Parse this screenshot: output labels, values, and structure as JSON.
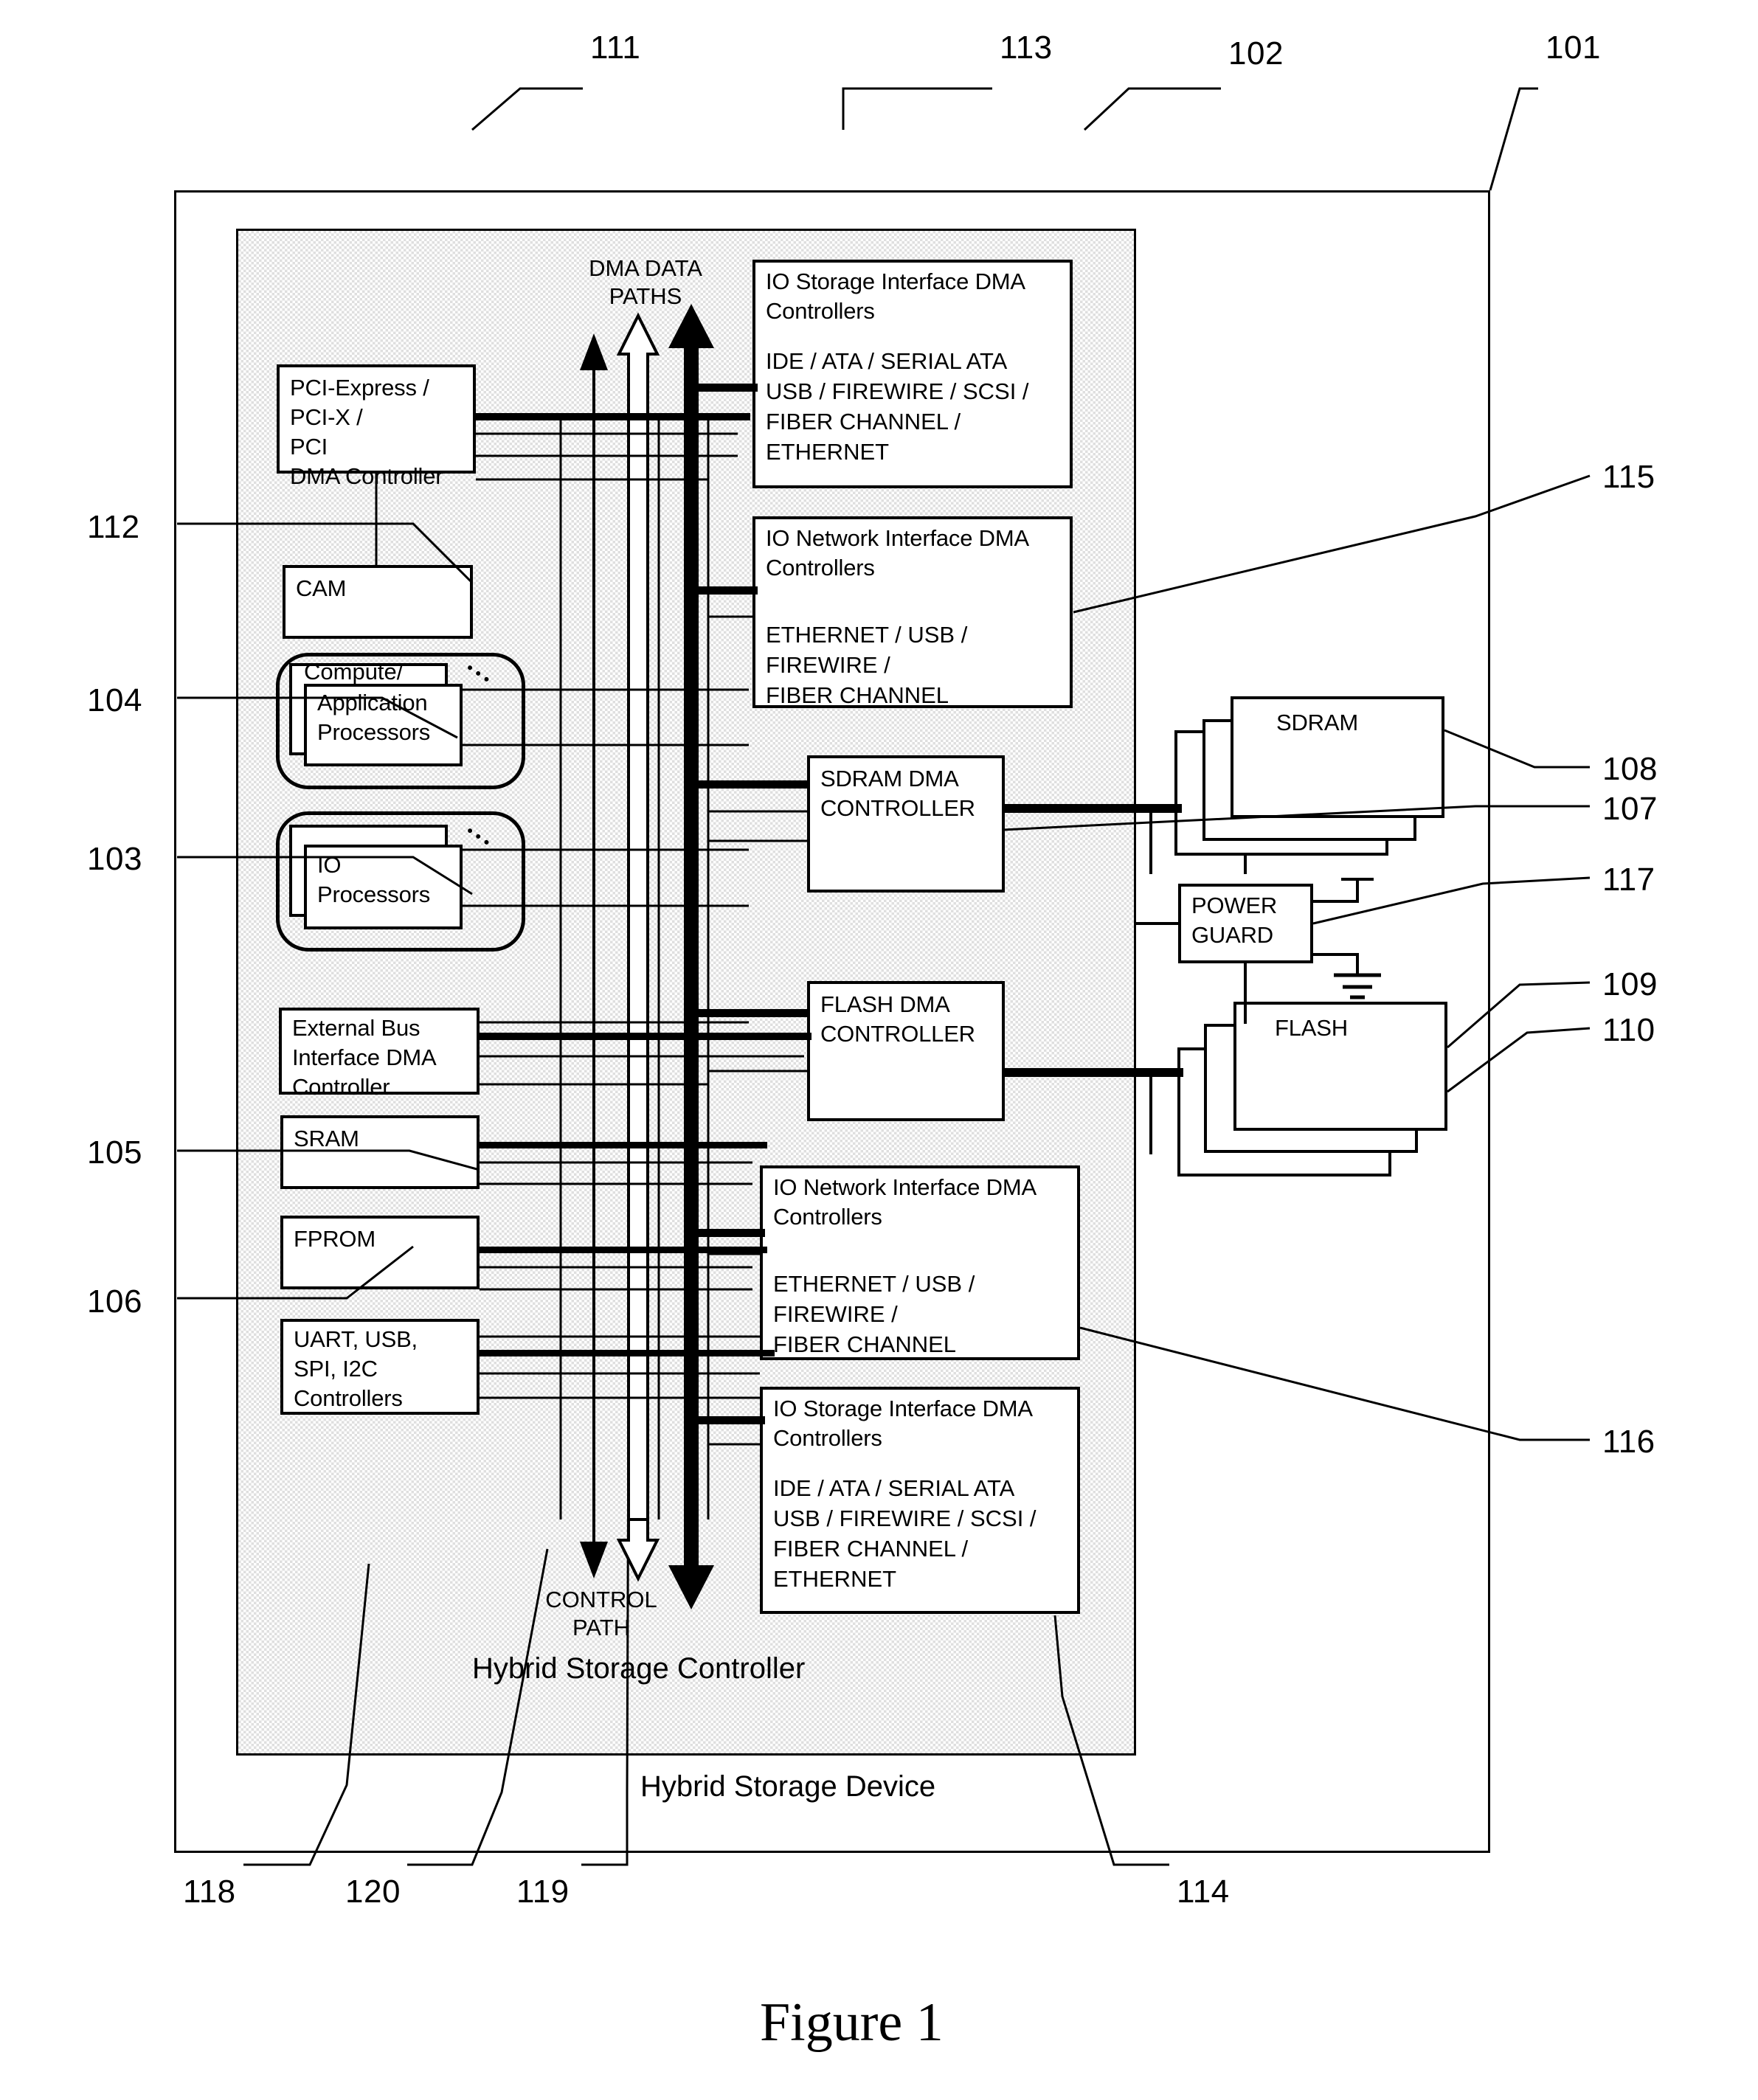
{
  "figure": {
    "caption": "Figure 1"
  },
  "outer": {
    "device_label": "Hybrid Storage Device",
    "ref": "101"
  },
  "controller": {
    "label": "Hybrid Storage Controller",
    "ref": "102"
  },
  "paths": {
    "dma_label_line1": "DMA DATA",
    "dma_label_line2": "PATHS",
    "dma_ref": "111",
    "control_label_line1": "CONTROL",
    "control_label_line2": "PATH",
    "control_refs": [
      "118",
      "120",
      "119"
    ]
  },
  "left_blocks": [
    {
      "id": "pci",
      "lines": [
        "PCI-Express /",
        "PCI-X /",
        "PCI",
        "DMA Controller"
      ]
    },
    {
      "id": "cam",
      "lines": [
        "CAM"
      ]
    },
    {
      "id": "compute",
      "lines": [
        "Compute/",
        "Application",
        "Processors"
      ],
      "dots": "•••"
    },
    {
      "id": "ioproc",
      "lines": [
        "IO",
        "Processors"
      ],
      "dots": "•••"
    },
    {
      "id": "extbus",
      "lines": [
        "External Bus",
        "Interface DMA",
        "Controller"
      ]
    },
    {
      "id": "sram",
      "lines": [
        "SRAM"
      ]
    },
    {
      "id": "fprom",
      "lines": [
        "FPROM"
      ]
    },
    {
      "id": "uart",
      "lines": [
        "UART, USB,",
        "SPI, I2C",
        "Controllers"
      ]
    }
  ],
  "center_blocks": [
    {
      "id": "io-storage-top",
      "title1": "IO Storage Interface DMA",
      "title2": "Controllers",
      "detail": [
        "IDE / ATA / SERIAL ATA",
        "USB / FIREWIRE / SCSI /",
        "FIBER CHANNEL /",
        "ETHERNET"
      ]
    },
    {
      "id": "io-network-top",
      "title1": "IO Network Interface DMA",
      "title2": "Controllers",
      "detail": [
        "ETHERNET / USB /",
        "FIREWIRE /",
        "FIBER CHANNEL"
      ]
    },
    {
      "id": "sdram-dma",
      "title1": "SDRAM DMA",
      "title2": "CONTROLLER",
      "detail": []
    },
    {
      "id": "flash-dma",
      "title1": "FLASH DMA",
      "title2": "CONTROLLER",
      "detail": []
    },
    {
      "id": "io-network-bottom",
      "title1": "IO Network Interface DMA",
      "title2": "Controllers",
      "detail": [
        "ETHERNET / USB /",
        "FIREWIRE /",
        "FIBER CHANNEL"
      ]
    },
    {
      "id": "io-storage-bottom",
      "title1": "IO Storage Interface DMA",
      "title2": "Controllers",
      "detail": [
        "IDE / ATA / SERIAL ATA",
        "USB / FIREWIRE / SCSI /",
        "FIBER CHANNEL /",
        "ETHERNET"
      ]
    }
  ],
  "right_blocks": [
    {
      "id": "sdram",
      "label": "SDRAM"
    },
    {
      "id": "power-guard",
      "label1": "POWER",
      "label2": "GUARD"
    },
    {
      "id": "flash",
      "label": "FLASH"
    }
  ],
  "refs": {
    "r101": "101",
    "r102": "102",
    "r103": "103",
    "r104": "104",
    "r105": "105",
    "r106": "106",
    "r107": "107",
    "r108": "108",
    "r109": "109",
    "r110": "110",
    "r111": "111",
    "r112": "112",
    "r113": "113",
    "r114": "114",
    "r115": "115",
    "r116": "116",
    "r117": "117",
    "r118": "118",
    "r119": "119",
    "r120": "120"
  },
  "colors": {
    "ink": "#000000",
    "paper": "#ffffff",
    "shade": "#d9d9d9"
  }
}
